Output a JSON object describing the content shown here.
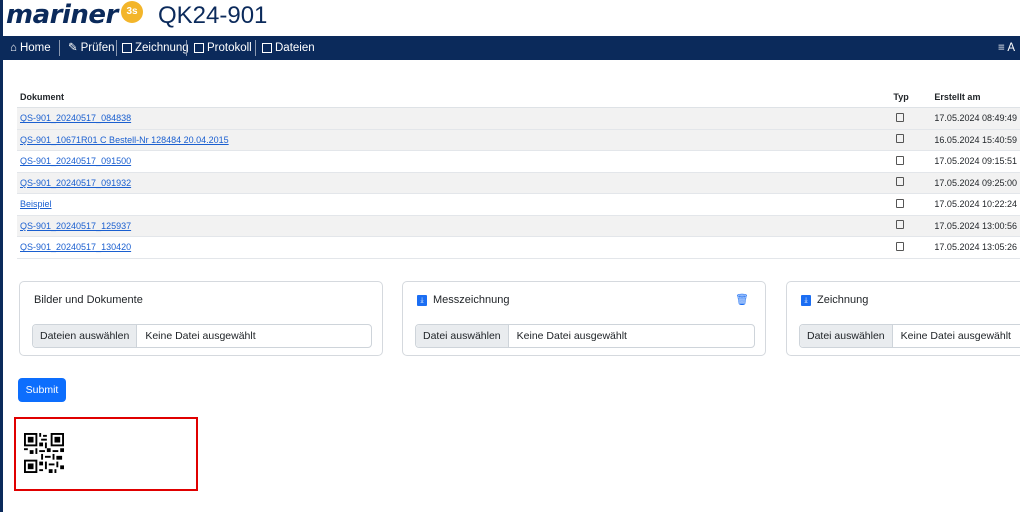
{
  "header": {
    "logo": "mariner",
    "logo_badge": "3s",
    "title": "QK24-901"
  },
  "nav": {
    "items": [
      {
        "label": "Home",
        "icon": "home-icon"
      },
      {
        "label": "Prüfen",
        "icon": "edit-icon"
      },
      {
        "label": "Zeichnung",
        "icon": "drawing-icon"
      },
      {
        "label": "Protokoll",
        "icon": "pdf-icon"
      },
      {
        "label": "Dateien",
        "icon": "files-icon"
      }
    ],
    "right_label": "≡ A"
  },
  "table": {
    "headers": {
      "document": "Dokument",
      "type": "Typ",
      "created": "Erstellt am"
    },
    "rows": [
      {
        "name": "QS-901_20240517_084838",
        "created": "17.05.2024 08:49:49"
      },
      {
        "name": "QS-901_10671R01 C Bestell-Nr 128484 20.04.2015",
        "created": "16.05.2024 15:40:59"
      },
      {
        "name": "QS-901_20240517_091500",
        "created": "17.05.2024 09:15:51"
      },
      {
        "name": "QS-901_20240517_091932",
        "created": "17.05.2024 09:25:00"
      },
      {
        "name": "Beispiel",
        "created": "17.05.2024 10:22:24"
      },
      {
        "name": "QS-901_20240517_125937",
        "created": "17.05.2024 13:00:56"
      },
      {
        "name": "QS-901_20240517_130420",
        "created": "17.05.2024 13:05:26"
      }
    ]
  },
  "cards": {
    "images": {
      "title": "Bilder und Dokumente",
      "button": "Dateien auswählen",
      "status": "Keine Datei ausgewählt"
    },
    "measure": {
      "title": "Messzeichnung",
      "button": "Datei auswählen",
      "status": "Keine Datei ausgewählt"
    },
    "drawing": {
      "title": "Zeichnung",
      "button": "Datei auswählen",
      "status": "Keine Datei ausgewählt"
    }
  },
  "submit_label": "Submit",
  "colors": {
    "navy": "#0b2a5b",
    "accent": "#0d6efd",
    "highlight": "#e00000"
  }
}
